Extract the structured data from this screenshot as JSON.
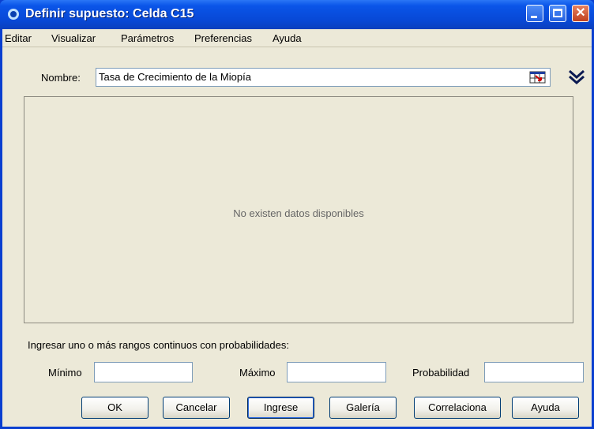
{
  "window": {
    "title": "Definir supuesto: Celda C15"
  },
  "menu": {
    "items": [
      "Editar",
      "Visualizar",
      "Parámetros",
      "Preferencias",
      "Ayuda"
    ]
  },
  "name_row": {
    "label": "Nombre:",
    "value": "Tasa de Crecimiento de la Miopía"
  },
  "chart_panel": {
    "message": "No existen datos disponibles"
  },
  "ranges": {
    "instruction": "Ingresar uno o más rangos continuos con probabilidades:",
    "min_label": "Mínimo",
    "min_value": "",
    "max_label": "Máximo",
    "max_value": "",
    "prob_label": "Probabilidad",
    "prob_value": ""
  },
  "buttons": {
    "ok": "OK",
    "cancel": "Cancelar",
    "enter": "Ingrese",
    "gallery": "Galería",
    "correlate": "Correlaciona",
    "help": "Ayuda"
  },
  "icons": {
    "title": "app-icon",
    "select_cell": "cell-reference-icon",
    "expand": "double-chevron-down-icon",
    "minimize": "minimize-icon",
    "maximize": "maximize-icon",
    "close": "close-icon"
  }
}
